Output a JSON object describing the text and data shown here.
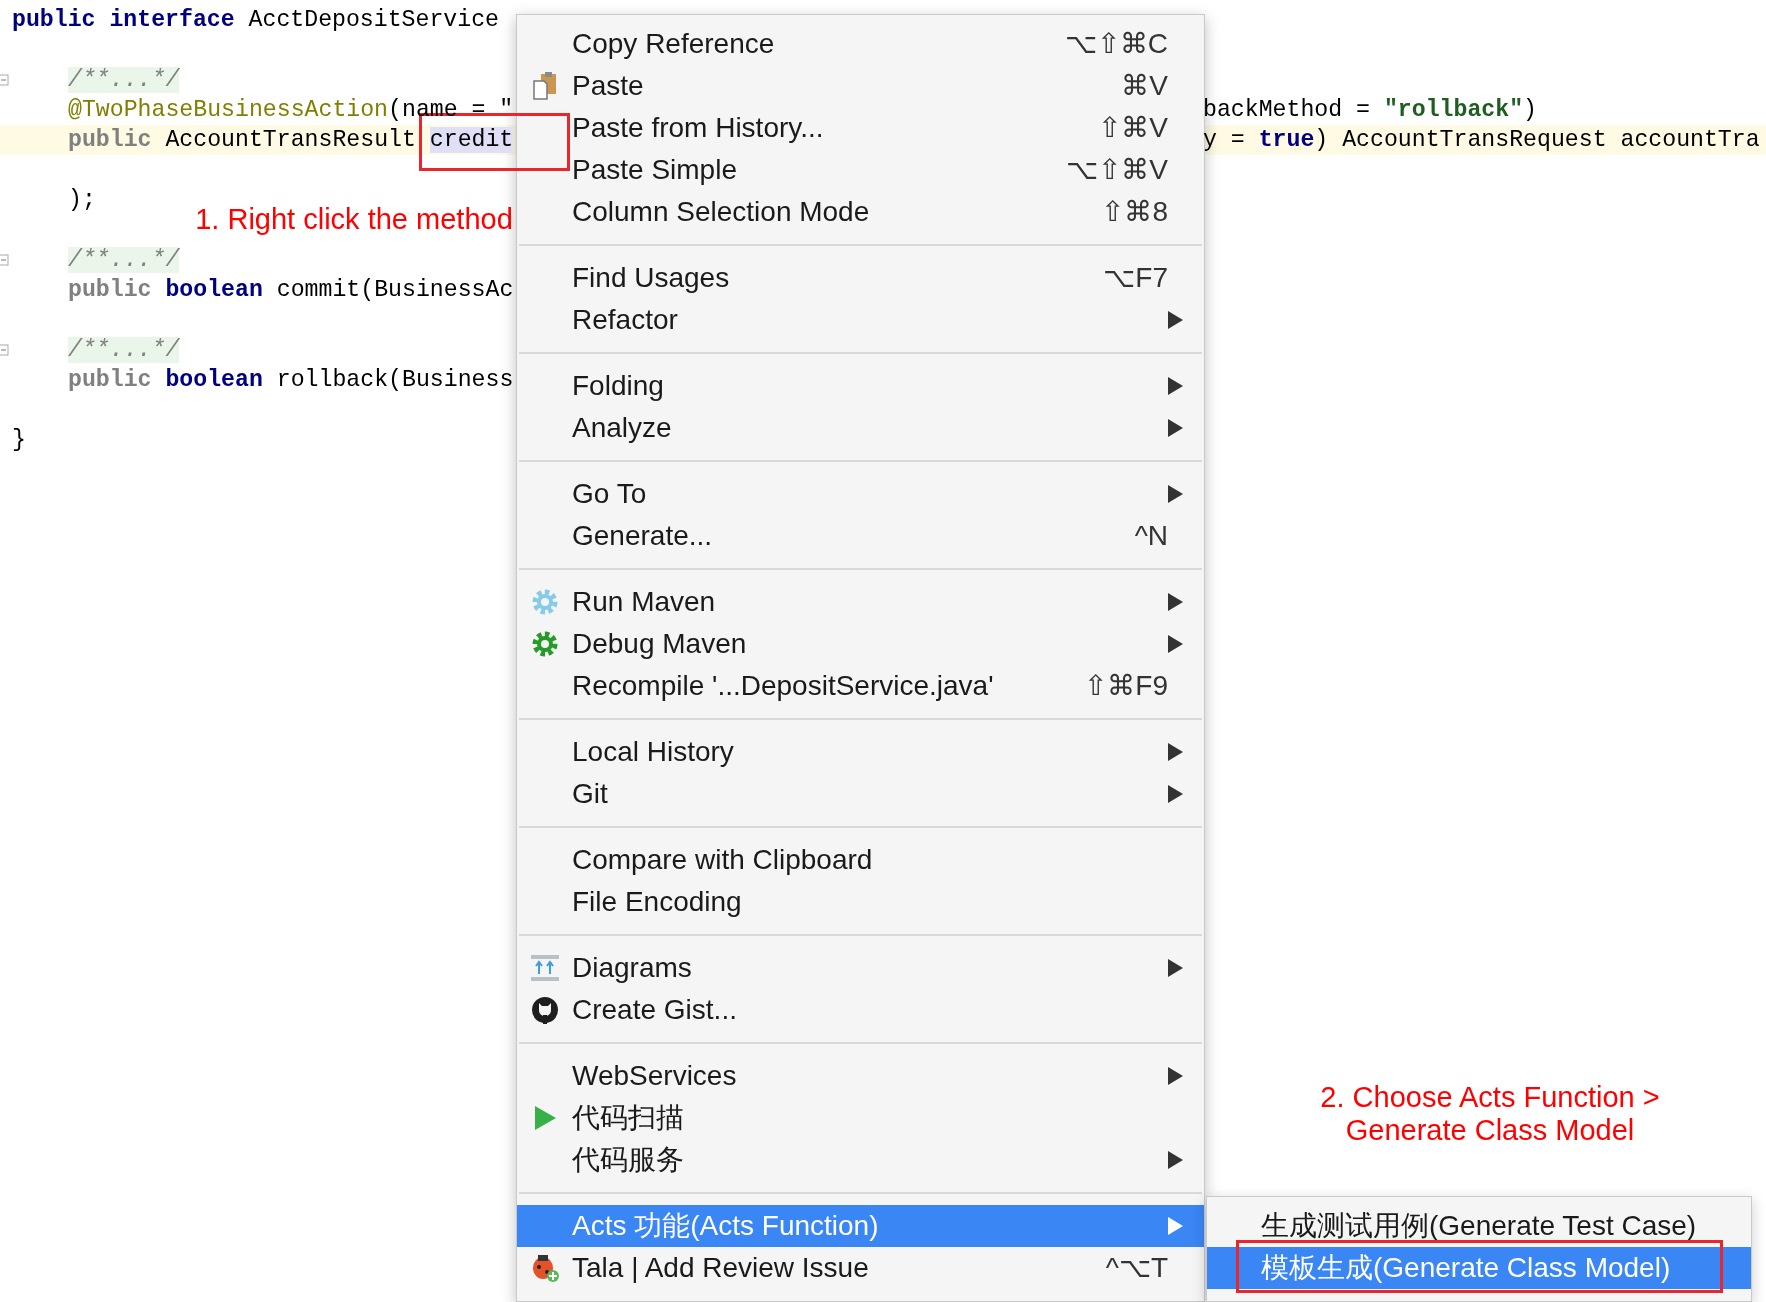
{
  "editor": {
    "lines": [
      {
        "kind": "top",
        "current": false,
        "folded": false,
        "left": [
          {
            "kind": "keyword",
            "text": "public interface"
          },
          {
            "kind": "plain",
            "text": " AcctDepositService"
          }
        ]
      },
      {
        "kind": "blank"
      },
      {
        "kind": "member",
        "current": false,
        "folded": true,
        "left": [
          {
            "kind": "comment",
            "text": "/**...*/"
          }
        ]
      },
      {
        "kind": "member",
        "current": false,
        "folded": false,
        "left": [
          {
            "kind": "annotation",
            "text": "@TwoPhaseBusinessAction"
          },
          {
            "kind": "plain",
            "text": "(name = \""
          }
        ],
        "right": [
          {
            "kind": "plain",
            "text": "backMethod = "
          },
          {
            "kind": "string",
            "text": "\"rollback\""
          },
          {
            "kind": "plain",
            "text": ")"
          }
        ]
      },
      {
        "kind": "member",
        "current": true,
        "folded": false,
        "left": [
          {
            "kind": "muted",
            "text": "public"
          },
          {
            "kind": "plain",
            "text": " AccountTransResult "
          },
          {
            "kind": "selected",
            "text": "credit"
          }
        ],
        "right": [
          {
            "kind": "plain",
            "text": "y = "
          },
          {
            "kind": "keyword",
            "text": "true"
          },
          {
            "kind": "plain",
            "text": ") AccountTransRequest accountTra"
          }
        ]
      },
      {
        "kind": "blank"
      },
      {
        "kind": "member",
        "current": false,
        "folded": false,
        "left": [
          {
            "kind": "plain",
            "text": ");"
          }
        ]
      },
      {
        "kind": "blank"
      },
      {
        "kind": "member",
        "current": false,
        "folded": true,
        "left": [
          {
            "kind": "comment",
            "text": "/**...*/"
          }
        ]
      },
      {
        "kind": "member",
        "current": false,
        "folded": false,
        "left": [
          {
            "kind": "muted",
            "text": "public"
          },
          {
            "kind": "keyword",
            "text": " boolean"
          },
          {
            "kind": "plain",
            "text": " commit(BusinessAc"
          }
        ]
      },
      {
        "kind": "blank"
      },
      {
        "kind": "member",
        "current": false,
        "folded": true,
        "left": [
          {
            "kind": "comment",
            "text": "/**...*/"
          }
        ]
      },
      {
        "kind": "member",
        "current": false,
        "folded": false,
        "left": [
          {
            "kind": "muted",
            "text": "public"
          },
          {
            "kind": "keyword",
            "text": " boolean"
          },
          {
            "kind": "plain",
            "text": " rollback(Business"
          }
        ]
      },
      {
        "kind": "blank"
      },
      {
        "kind": "top",
        "current": false,
        "folded": false,
        "left": [
          {
            "kind": "plain",
            "text": "}"
          }
        ]
      }
    ]
  },
  "callouts": [
    {
      "lines": [
        "1. Right click the method"
      ]
    },
    {
      "lines": [
        "2. Choose Acts Function >",
        "Generate Class Model"
      ]
    }
  ],
  "menu": {
    "groups": [
      {
        "items": [
          {
            "label": "Copy Reference",
            "shortcut": "⌥⇧⌘C",
            "submenu": false,
            "selected": false
          },
          {
            "label": "Paste",
            "kind": "clipboard",
            "shortcut": "⌘V",
            "submenu": false,
            "selected": false
          },
          {
            "label": "Paste from History...",
            "shortcut": "⇧⌘V",
            "submenu": false,
            "selected": false
          },
          {
            "label": "Paste Simple",
            "shortcut": "⌥⇧⌘V",
            "submenu": false,
            "selected": false
          },
          {
            "label": "Column Selection Mode",
            "shortcut": "⇧⌘8",
            "submenu": false,
            "selected": false
          }
        ]
      },
      {
        "items": [
          {
            "label": "Find Usages",
            "shortcut": "⌥F7",
            "submenu": false,
            "selected": false
          },
          {
            "label": "Refactor",
            "submenu": true,
            "selected": false
          }
        ]
      },
      {
        "items": [
          {
            "label": "Folding",
            "submenu": true,
            "selected": false
          },
          {
            "label": "Analyze",
            "submenu": true,
            "selected": false
          }
        ]
      },
      {
        "items": [
          {
            "label": "Go To",
            "submenu": true,
            "selected": false
          },
          {
            "label": "Generate...",
            "shortcut": "^N",
            "submenu": false,
            "selected": false
          }
        ]
      },
      {
        "items": [
          {
            "label": "Run Maven",
            "kind": "run",
            "submenu": true,
            "selected": false
          },
          {
            "label": "Debug Maven",
            "kind": "debug",
            "submenu": true,
            "selected": false
          },
          {
            "label": "Recompile '...DepositService.java'",
            "shortcut": "⇧⌘F9",
            "submenu": false,
            "selected": false
          }
        ]
      },
      {
        "items": [
          {
            "label": "Local History",
            "submenu": true,
            "selected": false
          },
          {
            "label": "Git",
            "submenu": true,
            "selected": false
          }
        ]
      },
      {
        "items": [
          {
            "label": "Compare with Clipboard",
            "submenu": false,
            "selected": false
          },
          {
            "label": "File Encoding",
            "submenu": false,
            "selected": false
          }
        ]
      },
      {
        "items": [
          {
            "label": "Diagrams",
            "kind": "diagram",
            "submenu": true,
            "selected": false
          },
          {
            "label": "Create Gist...",
            "kind": "gist",
            "submenu": false,
            "selected": false
          }
        ]
      },
      {
        "items": [
          {
            "label": "WebServices",
            "submenu": true,
            "selected": false
          },
          {
            "label": "代码扫描",
            "kind": "scan",
            "submenu": false,
            "selected": false
          },
          {
            "label": "代码服务",
            "submenu": true,
            "selected": false
          }
        ]
      },
      {
        "items": [
          {
            "label": "Acts 功能(Acts Function)",
            "submenu": true,
            "selected": true
          },
          {
            "label": "Tala | Add Review Issue",
            "kind": "review",
            "shortcut": "^⌥T",
            "submenu": false,
            "selected": false
          }
        ]
      }
    ]
  },
  "submenu": {
    "items": [
      {
        "label": "生成测试用例(Generate Test Case)",
        "selected": false
      },
      {
        "label": "模板生成(Generate Class Model)",
        "selected": true
      }
    ]
  }
}
